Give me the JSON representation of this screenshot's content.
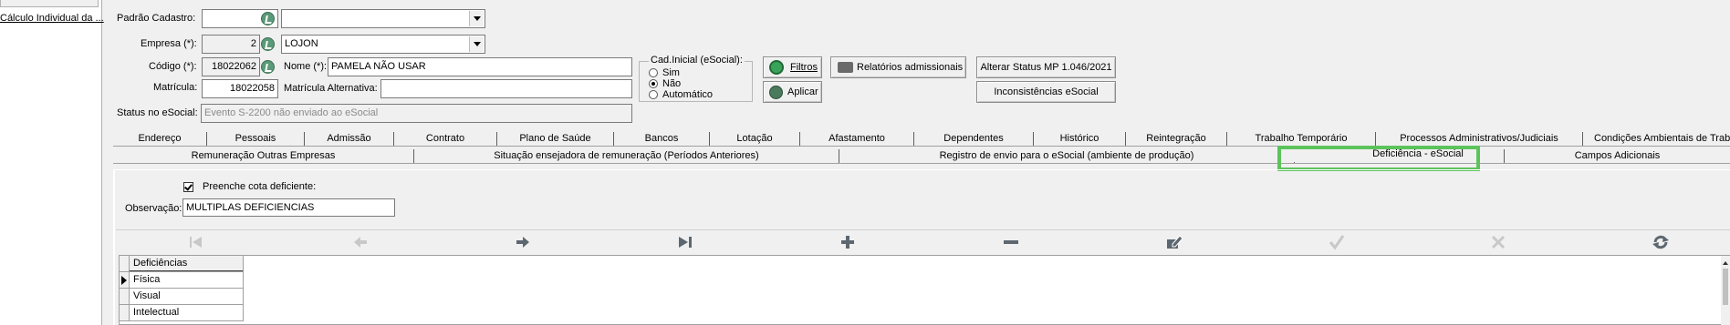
{
  "left_panel": {
    "link": "Cálculo Individual da ..."
  },
  "form": {
    "padrao_label": "Padrão Cadastro:",
    "padrao_code": "",
    "padrao_value": "",
    "empresa_label": "Empresa (*):",
    "empresa_code": "2",
    "empresa_value": "LOJON",
    "codigo_label": "Código (*):",
    "codigo_value": "18022062",
    "nome_label": "Nome (*):",
    "nome_value": "PAMELA  NÃO USAR",
    "matricula_label": "Matrícula:",
    "matricula_value": "18022058",
    "mat_alt_label": "Matrícula Alternativa:",
    "mat_alt_value": "",
    "status_label": "Status no eSocial:",
    "status_value": "Evento S-2200 não enviado ao eSocial"
  },
  "cad_inicial": {
    "title": "Cad.Inicial (eSocial):",
    "options": [
      "Sim",
      "Não",
      "Automático"
    ],
    "selected": "Não"
  },
  "buttons": {
    "filtros": "Filtros",
    "aplicar": "Aplicar",
    "relatorios": "Relatórios admissionais",
    "alterar_status": "Alterar Status MP 1.046/2021",
    "inconsistencias": "Inconsistências eSocial"
  },
  "tabs_row1": [
    "Endereço",
    "Pessoais",
    "Admissão",
    "Contrato",
    "Plano de Saúde",
    "Bancos",
    "Lotação",
    "Afastamento",
    "Dependentes",
    "Histórico",
    "Reintegração",
    "Trabalho Temporário",
    "Processos Administrativos/Judiciais",
    "Condições Ambientais de Trabalho"
  ],
  "tabs_row2": [
    "Remuneração Outras Empresas",
    "Situação ensejadora de remuneração (Períodos Anteriores)",
    "Registro de envio para o eSocial (ambiente de produção)",
    "Deficiência - eSocial",
    "Campos Adicionais"
  ],
  "active_tab": "Deficiência - eSocial",
  "deficiencia": {
    "cota_label": "Preenche cota deficiente:",
    "cota_checked": true,
    "obs_label": "Observação:",
    "obs_value": "MULTIPLAS DEFICIENCIAS"
  },
  "navigator": [
    "first-icon",
    "prior-icon",
    "next-icon",
    "last-icon",
    "insert-icon",
    "delete-icon",
    "edit-icon",
    "post-icon",
    "cancel-icon",
    "refresh-icon"
  ],
  "grid": {
    "header": "Deficiências",
    "rows": [
      "Física",
      "Visual",
      "Intelectual"
    ]
  },
  "colors": {
    "highlight": "#5cc35c",
    "lookup": "#5a9a78"
  }
}
